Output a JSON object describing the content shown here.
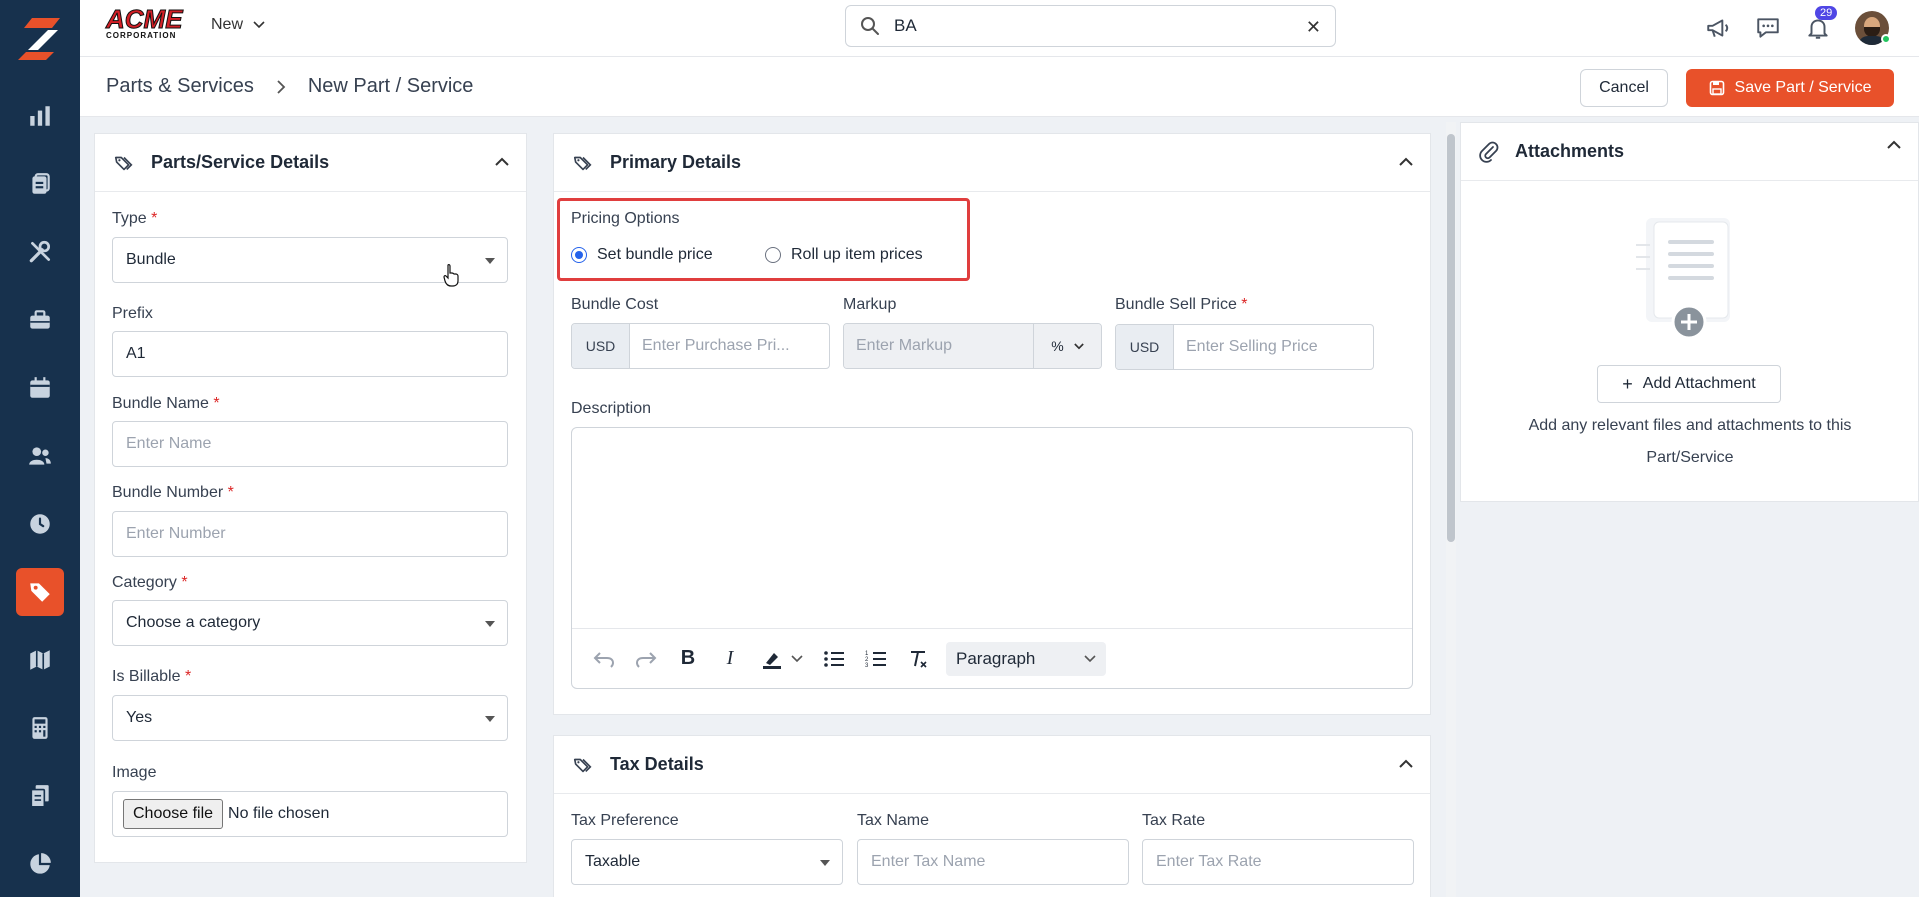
{
  "app": {
    "brand_name": "ACME",
    "brand_sub": "CORPORATION",
    "new_label": "New",
    "search_value": "BA",
    "notification_count": "29",
    "accent_color": "#e8512a",
    "sidebar_color": "#17314d"
  },
  "sidebar": {
    "items": [
      {
        "icon": "bar-chart-icon"
      },
      {
        "icon": "clipboard-icon"
      },
      {
        "icon": "tools-icon"
      },
      {
        "icon": "briefcase-icon"
      },
      {
        "icon": "calendar-icon"
      },
      {
        "icon": "users-icon"
      },
      {
        "icon": "clock-icon"
      },
      {
        "icon": "tag-icon",
        "active": true
      },
      {
        "icon": "map-icon"
      },
      {
        "icon": "calculator-icon"
      },
      {
        "icon": "documents-icon"
      },
      {
        "icon": "pie-chart-icon"
      }
    ]
  },
  "breadcrumb": {
    "parent": "Parts & Services",
    "current": "New Part / Service"
  },
  "actions": {
    "cancel": "Cancel",
    "save": "Save Part / Service"
  },
  "details": {
    "title": "Parts/Service Details",
    "type_label": "Type",
    "type_value": "Bundle",
    "prefix_label": "Prefix",
    "prefix_value": "A1",
    "name_label": "Bundle Name",
    "name_placeholder": "Enter Name",
    "number_label": "Bundle Number",
    "number_placeholder": "Enter Number",
    "category_label": "Category",
    "category_value": "Choose a category",
    "billable_label": "Is Billable",
    "billable_value": "Yes",
    "image_label": "Image",
    "file_button": "Choose file",
    "file_status": "No file chosen",
    "required_mark": "*"
  },
  "primary": {
    "title": "Primary Details",
    "pricing_label": "Pricing Options",
    "option_set": "Set bundle price",
    "option_rollup": "Roll up item prices",
    "cost_label": "Bundle Cost",
    "currency": "USD",
    "cost_placeholder": "Enter Purchase Pri...",
    "markup_label": "Markup",
    "markup_placeholder": "Enter Markup",
    "markup_unit": "%",
    "sell_label": "Bundle Sell Price",
    "sell_placeholder": "Enter Selling Price",
    "description_label": "Description",
    "paragraph_format": "Paragraph"
  },
  "tax": {
    "title": "Tax Details",
    "pref_label": "Tax Preference",
    "pref_value": "Taxable",
    "name_label": "Tax Name",
    "name_placeholder": "Enter Tax Name",
    "rate_label": "Tax Rate",
    "rate_placeholder": "Enter Tax Rate"
  },
  "attachments": {
    "title": "Attachments",
    "add_button": "Add Attachment",
    "help_line1": "Add any relevant files and attachments to this",
    "help_line2": "Part/Service"
  }
}
